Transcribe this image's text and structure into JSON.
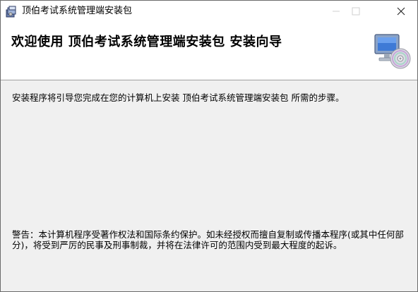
{
  "window": {
    "title": "顶伯考试系统管理端安装包",
    "icons": {
      "app": "installer-package-icon",
      "minimize": "minimize-icon",
      "maximize": "maximize-icon",
      "close": "close-icon",
      "header": "computer-cd-icon"
    }
  },
  "header": {
    "title": "欢迎使用  顶伯考试系统管理端安装包  安装向导"
  },
  "content": {
    "intro": "安装程序将引导您完成在您的计算机上安装  顶伯考试系统管理端安装包  所需的步骤。",
    "warning": "警告：本计算机程序受著作权法和国际条约保护。如未经授权而擅自复制或传播本程序(或其中任何部分)，将受到严厉的民事及刑事制裁，并将在法律许可的范围内受到最大程度的起诉。"
  },
  "colors": {
    "window_bg": "#f0f0f0",
    "header_bg": "#ffffff",
    "border": "#a0a0a0"
  }
}
